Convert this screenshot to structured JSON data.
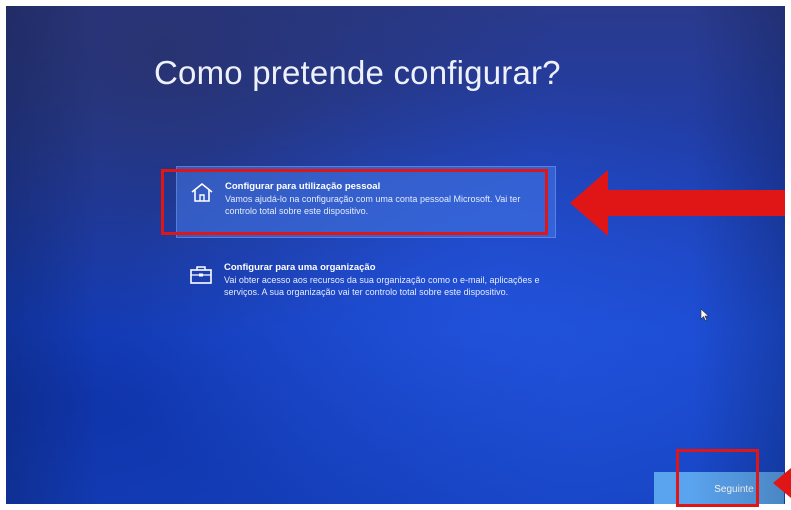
{
  "setup": {
    "title": "Como pretende configurar?",
    "options": [
      {
        "title": "Configurar para utilização pessoal",
        "description": "Vamos ajudá-lo na configuração com uma conta pessoal Microsoft. Vai ter controlo total sobre este dispositivo.",
        "icon": "home-icon",
        "selected": true
      },
      {
        "title": "Configurar para uma organização",
        "description": "Vai obter acesso aos recursos da sua organização como o e-mail, aplicações e serviços. A sua organização vai ter controlo total sobre este dispositivo.",
        "icon": "briefcase-icon",
        "selected": false
      }
    ],
    "next_label": "Seguinte"
  },
  "annotations": {
    "color": "#e01515"
  }
}
